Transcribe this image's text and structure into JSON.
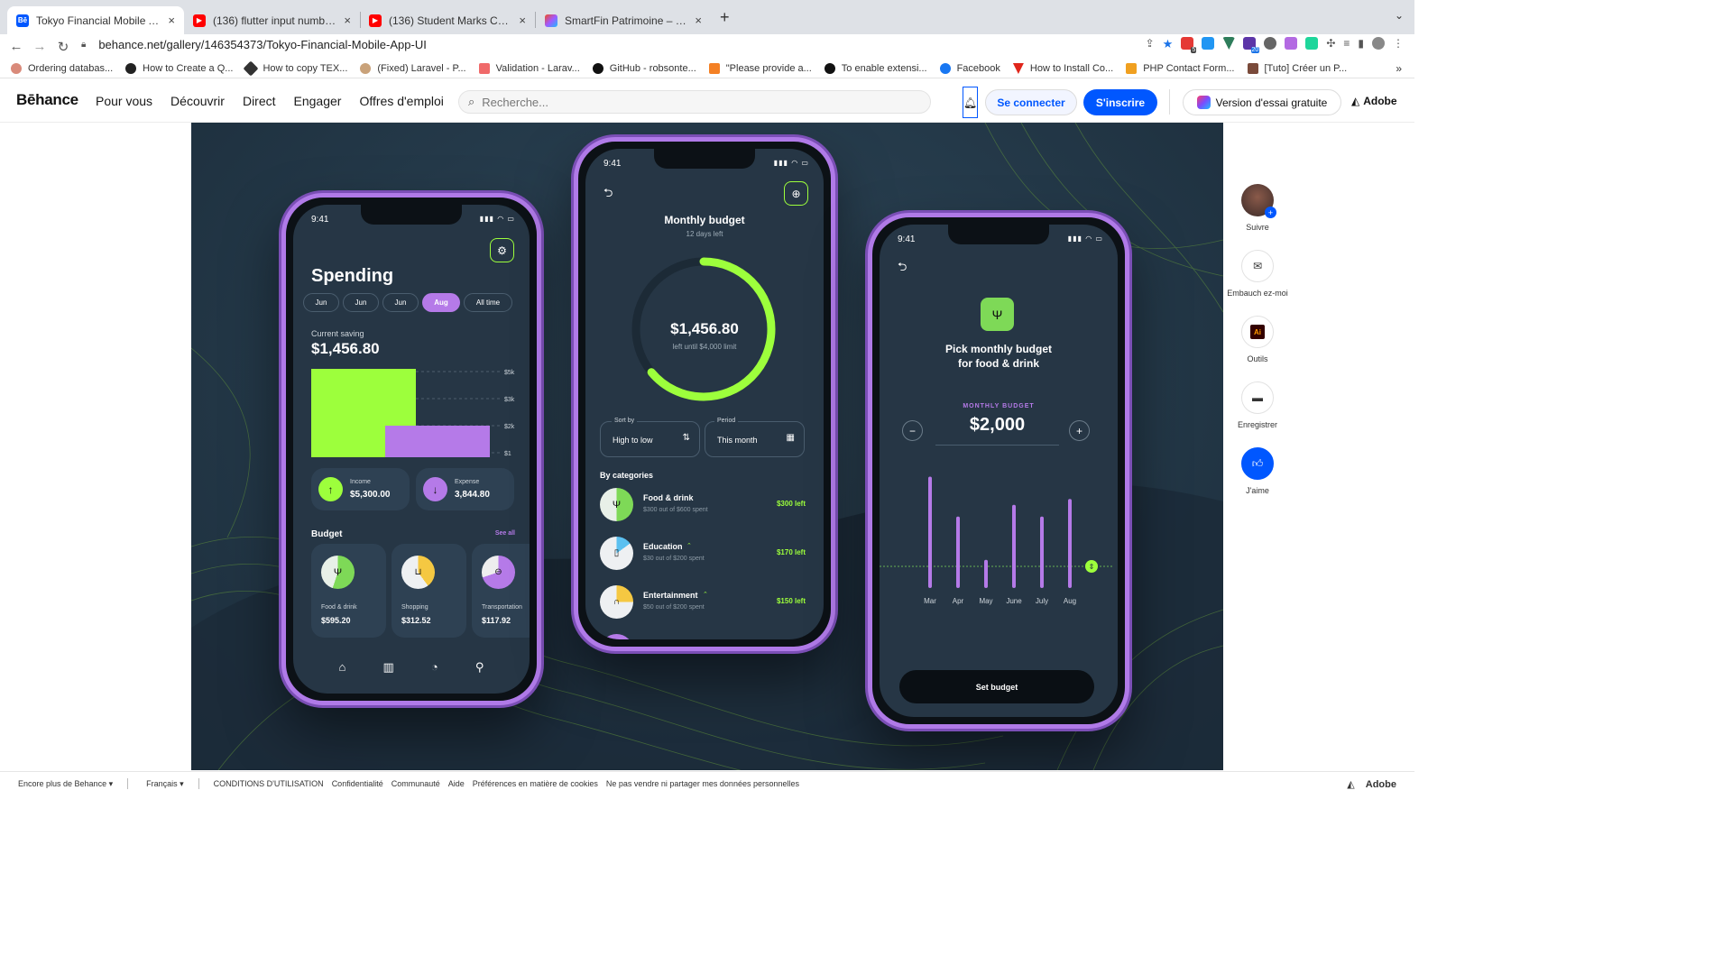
{
  "browser": {
    "tabs": [
      {
        "title": "Tokyo Financial Mobile App UI",
        "icon": "behance-icon",
        "active": true
      },
      {
        "title": "(136) flutter input number desi",
        "icon": "youtube-icon"
      },
      {
        "title": "(136) Student Marks Calculatio",
        "icon": "youtube-icon"
      },
      {
        "title": "SmartFin Patrimoine – Figma",
        "icon": "figma-icon"
      }
    ],
    "url": "behance.net/gallery/146354373/Tokyo-Financial-Mobile-App-UI",
    "bookmarks": [
      "Ordering databas...",
      "How to Create a Q...",
      "How to copy TEX...",
      "(Fixed) Laravel - P...",
      "Validation - Larav...",
      "GitHub - robsonte...",
      "\"Please provide a...",
      "To enable extensi...",
      "Facebook",
      "How to Install Co...",
      "PHP Contact Form...",
      "[Tuto] Créer un P..."
    ],
    "ext_badges": {
      "a": "5",
      "b": "20"
    },
    "tab_close": "×",
    "new_tab": "+",
    "more": "»"
  },
  "behance": {
    "logo": "Bēhance",
    "nav": [
      "Pour vous",
      "Découvrir",
      "Direct",
      "Engager",
      "Offres d'emploi"
    ],
    "search_placeholder": "Recherche...",
    "login": "Se connecter",
    "signup": "S'inscrire",
    "trial": "Version d'essai gratuite",
    "adobe": "Adobe"
  },
  "sidebar": {
    "items": [
      {
        "label": "Suivre"
      },
      {
        "label": "Embauch ez-moi"
      },
      {
        "label": "Outils"
      },
      {
        "label": "Enregistrer"
      },
      {
        "label": "J'aime"
      }
    ],
    "ai_label": "Ai"
  },
  "phone1": {
    "time": "9:41",
    "title": "Spending",
    "months": [
      "Jun",
      "Jun",
      "Jun",
      "Aug",
      "All time"
    ],
    "saving_label": "Current saving",
    "saving_value": "$1,456.80",
    "ticks": [
      "$5k",
      "$3k",
      "$2k",
      "$1"
    ],
    "bar_colors": [
      "#9dff3c",
      "#b57ae8"
    ],
    "income_label": "Income",
    "income_value": "$5,300.00",
    "expense_label": "Expense",
    "expense_value": "3,844.80",
    "budget_title": "Budget",
    "see_all": "See all",
    "budgets": [
      {
        "name": "Food & drink",
        "value": "$595.20"
      },
      {
        "name": "Shopping",
        "value": "$312.52"
      },
      {
        "name": "Transportation",
        "value": "$117.92"
      }
    ]
  },
  "phone2": {
    "time": "9:41",
    "title": "Monthly budget",
    "subtitle": "12 days left",
    "amount": "$1,456.80",
    "amount_sub": "left until $4,000 limit",
    "ring_progress": 0.64,
    "sort_label": "Sort by",
    "sort_value": "High to low",
    "period_label": "Period",
    "period_value": "This month",
    "section": "By categories",
    "categories": [
      {
        "name": "Food & drink",
        "detail": "$300 out of $600 spent",
        "left": "$300 left",
        "color": "#7ed957"
      },
      {
        "name": "Education",
        "detail": "$30 out of $200 spent",
        "left": "$170 left",
        "color": "#5bc0f0"
      },
      {
        "name": "Entertainment",
        "detail": "$50 out of $200 spent",
        "left": "$150 left",
        "color": "#f5c842"
      }
    ]
  },
  "phone3": {
    "time": "9:41",
    "title_line1": "Pick monthly budget",
    "title_line2": "for food & drink",
    "budget_label": "MONTHLY BUDGET",
    "budget_value": "$2,000",
    "months": [
      "Mar",
      "Apr",
      "May",
      "June",
      "July",
      "Aug"
    ],
    "bar_levels": [
      0.95,
      0.61,
      0.24,
      0.71,
      0.61,
      0.76
    ],
    "button": "Set budget"
  },
  "footer": {
    "items": [
      "Encore plus de Behance ▾",
      "Français ▾",
      "CONDITIONS D'UTILISATION",
      "Confidentialité",
      "Communauté",
      "Aide",
      "Préférences en matière de cookies",
      "Ne pas vendre ni partager mes données personnelles"
    ],
    "adobe": "Adobe"
  }
}
